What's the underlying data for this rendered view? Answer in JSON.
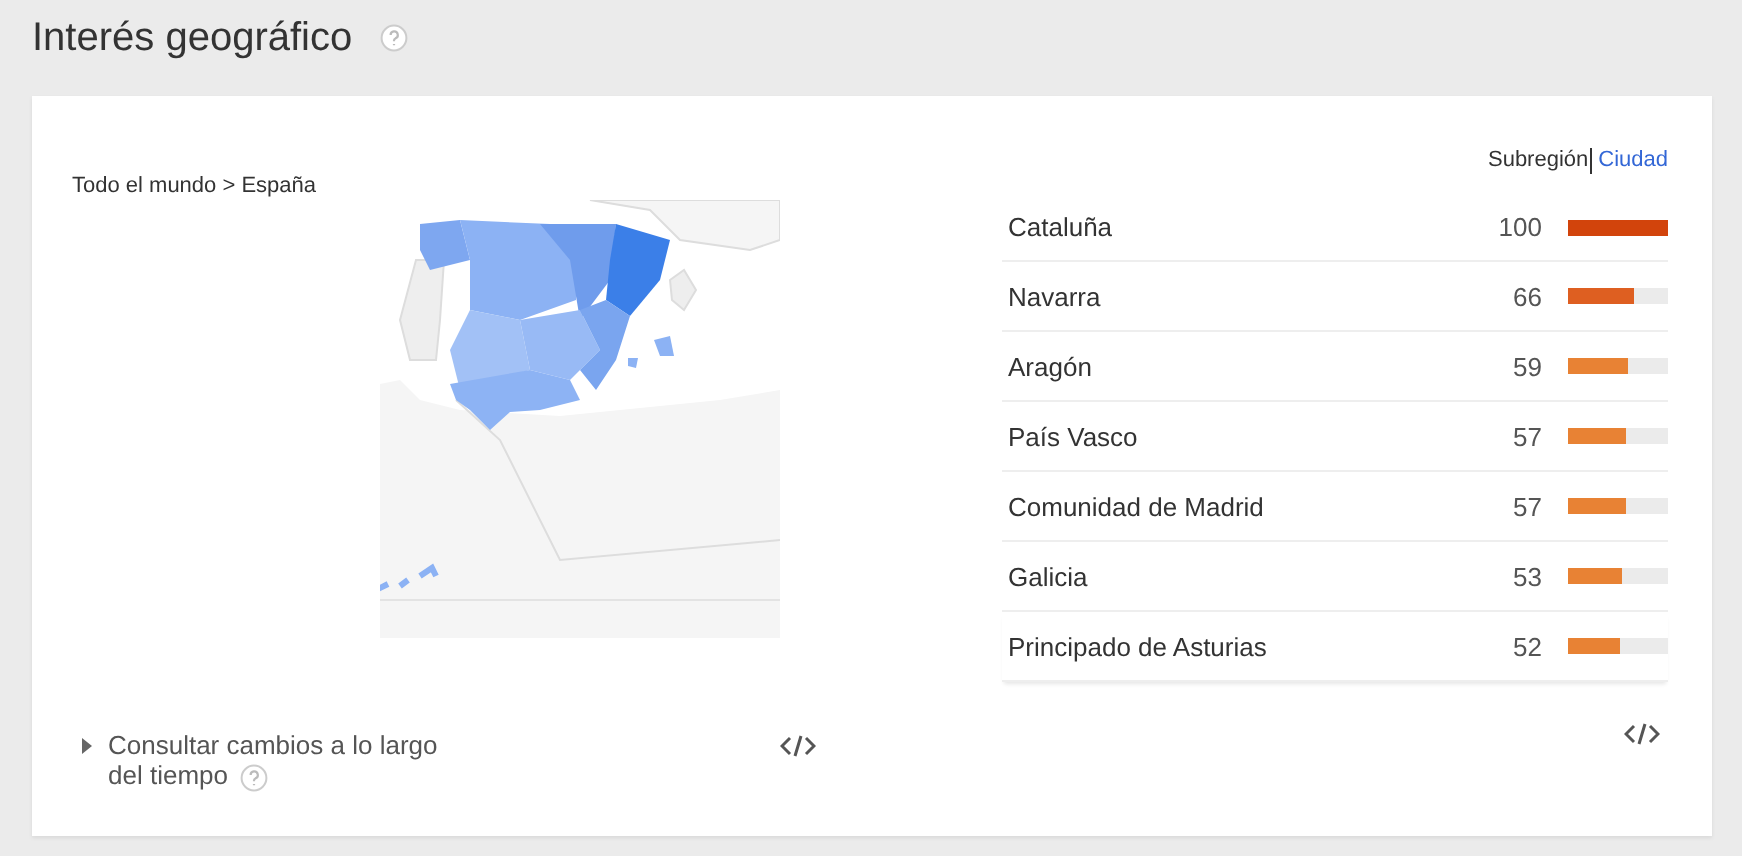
{
  "title": "Interés geográfico",
  "breadcrumb": "Todo el mundo > España",
  "resolution_tabs": [
    {
      "label": "Subregión",
      "selected": true
    },
    {
      "label": "Ciudad",
      "selected": false
    }
  ],
  "regions": [
    {
      "name": "Cataluña",
      "value": "100",
      "level": 1.0
    },
    {
      "name": "Navarra",
      "value": "66",
      "level": 0.66
    },
    {
      "name": "Aragón",
      "value": "59",
      "level": 0.59
    },
    {
      "name": "País Vasco",
      "value": "57",
      "level": 0.57
    },
    {
      "name": "Comunidad de Madrid",
      "value": "57",
      "level": 0.57
    },
    {
      "name": "Galicia",
      "value": "53",
      "level": 0.53
    },
    {
      "name": "Principado de Asturias",
      "value": "52",
      "level": 0.52
    }
  ],
  "time_toggle": {
    "label": "Consultar cambios a lo largo del tiempo",
    "expanded": false
  }
}
